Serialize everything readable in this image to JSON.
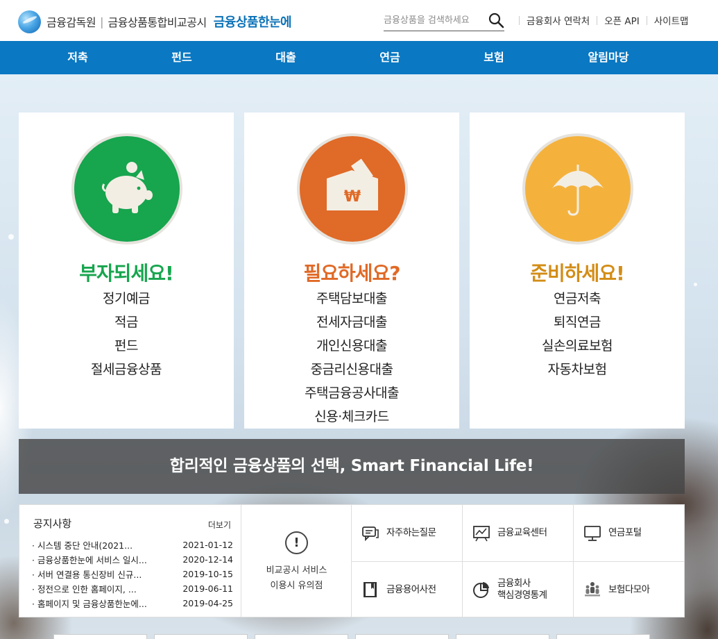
{
  "header": {
    "org_name": "금융감독원",
    "service_name": "금융상품통합비교공시",
    "brand": "금융상품한눈에",
    "search_placeholder": "금융상품을 검색하세요",
    "util_links": [
      "금융회사 연락처",
      "오픈 API",
      "사이트맵"
    ]
  },
  "nav": [
    "저축",
    "펀드",
    "대출",
    "연금",
    "보험",
    "알림마당"
  ],
  "cards": [
    {
      "title": "부자되세요!",
      "color": "#17a54e",
      "icon": "piggy-bank-icon",
      "items": [
        "정기예금",
        "적금",
        "펀드",
        "절세금융상품"
      ]
    },
    {
      "title": "필요하세요?",
      "color": "#e06a27",
      "icon": "won-envelope-icon",
      "items": [
        "주택담보대출",
        "전세자금대출",
        "개인신용대출",
        "중금리신용대출",
        "주택금융공사대출",
        "신용·체크카드"
      ]
    },
    {
      "title": "준비하세요!",
      "color": "#f4b23d",
      "icon": "umbrella-icon",
      "items": [
        "연금저축",
        "퇴직연금",
        "실손의료보험",
        "자동차보험"
      ]
    }
  ],
  "banner": "합리적인 금융상품의 선택, Smart Financial Life!",
  "notice": {
    "title": "공지사항",
    "more": "더보기",
    "items": [
      {
        "title": "시스템 중단 안내(2021...",
        "date": "2021-01-12"
      },
      {
        "title": "금융상품한눈에 서비스 일시...",
        "date": "2020-12-14"
      },
      {
        "title": "서버 연결용 통신장비 신규...",
        "date": "2019-10-15"
      },
      {
        "title": "정전으로 인한 홈페이지, ...",
        "date": "2019-06-11"
      },
      {
        "title": "홈페이지 및 금융상품한눈에...",
        "date": "2019-04-25"
      }
    ]
  },
  "guide": {
    "icon": "!",
    "line1": "비교공시 서비스",
    "line2": "이용시 유의점"
  },
  "quick_links": [
    {
      "label": "자주하는질문",
      "icon": "chat-icon"
    },
    {
      "label": "금융교육센터",
      "icon": "chart-board-icon"
    },
    {
      "label": "연금포털",
      "icon": "monitor-icon"
    },
    {
      "label": "금융용어사전",
      "icon": "book-icon"
    },
    {
      "label_1": "금융회사",
      "label_2": "핵심경영통계",
      "icon": "pie-chart-icon"
    },
    {
      "label": "보험다모아",
      "icon": "people-icon"
    }
  ]
}
